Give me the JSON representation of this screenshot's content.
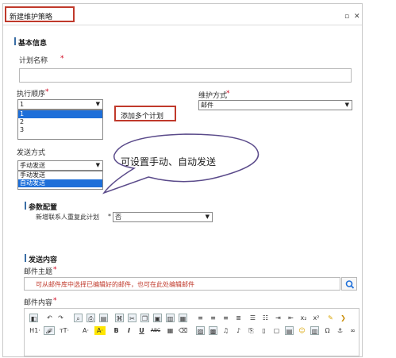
{
  "dialog": {
    "title": "新建维护策略"
  },
  "basic": {
    "section_title": "基本信息",
    "plan_name_label": "计划名称",
    "required_mark": "*",
    "order_label": "执行顺序",
    "order_required": "*",
    "order_value": "1",
    "order_options": [
      "1",
      "2",
      "3"
    ],
    "callout_multi": "添加多个计划",
    "maintain_label": "维护方式",
    "maintain_required": "*",
    "maintain_value": "邮件",
    "send_label": "发送方式",
    "send_value": "手动发送",
    "send_options": [
      "手动发送",
      "自动发送"
    ],
    "bubble_text": "可设置手动、自动发送"
  },
  "params": {
    "section_title": "参数配置",
    "repeat_label": "新增联系人重复此计划",
    "repeat_value": "否"
  },
  "content": {
    "section_title": "发送内容",
    "subject_label": "邮件主题",
    "subject_required": "*",
    "subject_value": "可从邮件库中选择已编辑好的邮件，也可在此处编辑邮件",
    "body_label": "邮件内容",
    "body_required": "*",
    "toolbar_text": {
      "h1": "H1·",
      "font": "𝓕·",
      "tt": "тT·",
      "forecolor": "A·",
      "backcolor": "A·",
      "bold": "B",
      "italic": "I",
      "underline": "U",
      "abc": "ABC"
    }
  }
}
